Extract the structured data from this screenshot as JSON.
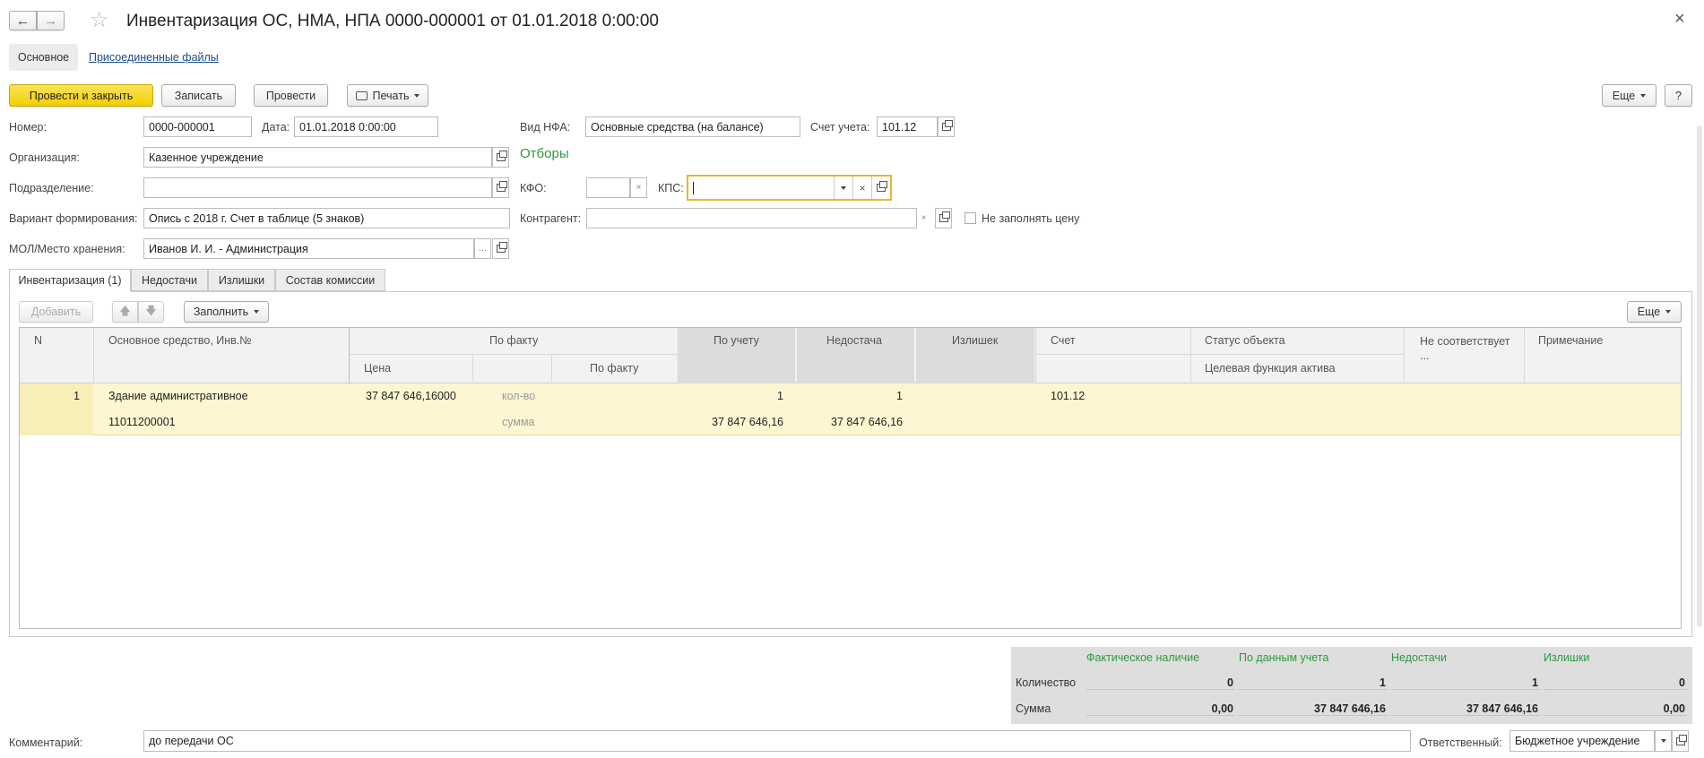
{
  "window": {
    "title": "Инвентаризация ОС, НМА, НПА 0000-000001 от 01.01.2018 0:00:00",
    "close": "×"
  },
  "sections": {
    "main": "Основное",
    "files": "Присоединенные файлы"
  },
  "toolbar": {
    "post_close": "Провести и закрыть",
    "save": "Записать",
    "post": "Провести",
    "print": "Печать",
    "more": "Еще",
    "help": "?"
  },
  "form": {
    "number_label": "Номер:",
    "number_value": "0000-000001",
    "date_label": "Дата:",
    "date_value": "01.01.2018  0:00:00",
    "nfa_label": "Вид НФА:",
    "nfa_value": "Основные средства (на балансе)",
    "account_label": "Счет учета:",
    "account_value": "101.12",
    "org_label": "Организация:",
    "org_value": "Казенное учреждение",
    "filters_title": "Отборы",
    "dept_label": "Подразделение:",
    "dept_value": "",
    "kfo_label": "КФО:",
    "kfo_value": "",
    "kps_label": "КПС:",
    "kps_value": "",
    "variant_label": "Вариант формирования:",
    "variant_value": "Опись с 2018 г. Счет в таблице (5 знаков)",
    "counterparty_label": "Контрагент:",
    "counterparty_value": "",
    "no_fill_price": "Не заполнять цену",
    "mol_label": "МОЛ/Место хранения:",
    "mol_value": "Иванов И. И. - Администрация"
  },
  "tabs": [
    "Инвентаризация (1)",
    "Недостачи",
    "Излишки",
    "Состав комиссии"
  ],
  "table_toolbar": {
    "add": "Добавить",
    "fill": "Заполнить",
    "more": "Еще"
  },
  "table": {
    "headers": {
      "n": "N",
      "asset": "Основное средство, Инв.№",
      "by_fact": "По факту",
      "price": "Цена",
      "by_fact_sub": "По факту",
      "by_account": "По учету",
      "shortage": "Недостача",
      "surplus": "Излишек",
      "account": "Счет",
      "status": "Статус объекта",
      "target": "Целевая функция актива",
      "mismatch": "Не соответствует ...",
      "note": "Примечание"
    },
    "row": {
      "n": "1",
      "asset_name": "Здание административное",
      "inv_no": "11011200001",
      "price": "37 847 646,16000",
      "qty_label": "кол-во",
      "sum_label": "сумма",
      "by_account_qty": "1",
      "by_account_sum": "37 847 646,16",
      "shortage_qty": "1",
      "shortage_sum": "37 847 646,16",
      "account": "101.12"
    }
  },
  "summary": {
    "headers": [
      "Фактическое наличие",
      "По данным учета",
      "Недостачи",
      "Излишки"
    ],
    "qty_label": "Количество",
    "sum_label": "Сумма",
    "qty": [
      "0",
      "1",
      "1",
      "0"
    ],
    "sum": [
      "0,00",
      "37 847 646,16",
      "37 847 646,16",
      "0,00"
    ]
  },
  "footer": {
    "comment_label": "Комментарий:",
    "comment_value": "до передачи ОС",
    "responsible_label": "Ответственный:",
    "responsible_value": "Бюджетное учреждение"
  },
  "colors": {
    "primary": "#f2cf00",
    "green": "#2d9a3b",
    "row_highlight": "#fdf6d2"
  }
}
